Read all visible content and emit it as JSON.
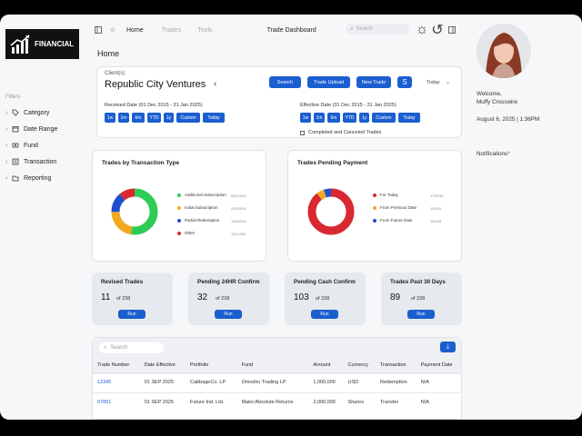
{
  "brand": {
    "name": "FINANCIAL"
  },
  "sidebar": {
    "filters_label": "Filters",
    "items": [
      {
        "label": "Category",
        "icon": "tag-icon"
      },
      {
        "label": "Date Range",
        "icon": "calendar-icon"
      },
      {
        "label": "Fund",
        "icon": "fund-icon"
      },
      {
        "label": "Transaction",
        "icon": "transaction-icon"
      },
      {
        "label": "Reporting",
        "icon": "folder-icon"
      }
    ]
  },
  "topbar": {
    "breadcrumbs": [
      "Home",
      "Trades",
      "Tools"
    ],
    "title": "Trade Dashboard",
    "search_placeholder": "Search"
  },
  "page": {
    "title": "Home"
  },
  "client": {
    "label": "Client(s)",
    "name": "Republic City Ventures",
    "actions": [
      "Search",
      "Trade Upload",
      "New Trade"
    ],
    "period": "Today",
    "received_label": "Received Date (01 Dec 2015 - 31 Jan 2025)",
    "effective_label": "Effective Date (31 Dec 2015 - 31 Jan 2025)",
    "received_chips": [
      "1w",
      "1m",
      "6m",
      "YTD",
      "1y",
      "Custom",
      "Today"
    ],
    "effective_chips": [
      "1w",
      "1m",
      "6m",
      "YTD",
      "1y",
      "Custom",
      "Today"
    ],
    "checkbox_label": "Completed and Canceled Trades"
  },
  "user": {
    "welcome": "Welcome,",
    "name": "Muffy Crosswire",
    "datetime": "August 6, 2025 | 1:36PM",
    "notifications": "Notifications"
  },
  "charts": {
    "transaction_type_title": "Trades by Transaction Type",
    "pending_payment_title": "Trades Pending Payment"
  },
  "chart_data": [
    {
      "type": "pie",
      "title": "Trades by Transaction Type",
      "categories": [
        "Additional Subscription",
        "Initial Subscription",
        "Partial Redemption",
        "Other"
      ],
      "values": [
        521,
        220,
        139,
        112
      ],
      "labels": [
        "521/1000",
        "220/1000",
        "139/1000",
        "112/1000"
      ],
      "colors": [
        "#2ecc55",
        "#f2a81f",
        "#1f4fcf",
        "#d9282f"
      ]
    },
    {
      "type": "pie",
      "title": "Trades Pending Payment",
      "categories": [
        "For Today",
        "From Previous Date",
        "From Future Date"
      ],
      "values": [
        170,
        10,
        10
      ],
      "labels": [
        "170/195",
        "10/195",
        "10/195"
      ],
      "colors": [
        "#d9282f",
        "#f2a81f",
        "#1f4fcf"
      ]
    }
  ],
  "stats": [
    {
      "title": "Revised Trades",
      "value": "11",
      "of": "of 238",
      "run": "Run"
    },
    {
      "title": "Pending 24HR Confirm",
      "value": "32",
      "of": "of 238",
      "run": "Run"
    },
    {
      "title": "Pending Cash Confirm",
      "value": "103",
      "of": "of 238",
      "run": "Run"
    },
    {
      "title": "Trades Past 30 Days",
      "value": "89",
      "of": "of 238",
      "run": "Run"
    }
  ],
  "table": {
    "search_placeholder": "Search",
    "columns": [
      "Trade Number",
      "Date Effective",
      "Portfolio",
      "Fund",
      "Amount",
      "Currency",
      "Transaction",
      "Payment Date"
    ],
    "rows": [
      [
        "12345",
        "01 SEP 2025",
        "CabbageCo. LP",
        "Omoshu Trading LP",
        "1,000,000",
        "USD",
        "Redemption",
        "N/A"
      ],
      [
        "67891",
        "01 SEP 2025",
        "Future Ind. Ltd.",
        "Mako Absolute Returns",
        "2,000,000",
        "Shares",
        "Transfer",
        "N/A"
      ]
    ]
  },
  "colors": {
    "accent": "#1b5ed0",
    "notification_dot": "#e03030"
  }
}
